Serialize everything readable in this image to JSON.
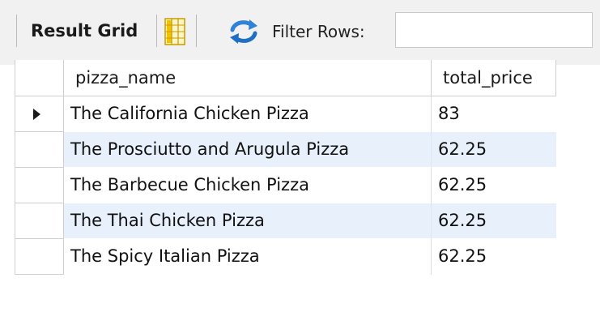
{
  "toolbar": {
    "title": "Result Grid",
    "filter_label": "Filter Rows:",
    "filter_value": "",
    "grid_icon": "grid-layout-icon",
    "refresh_icon": "refresh-icon"
  },
  "table": {
    "columns": [
      "pizza_name",
      "total_price"
    ],
    "rows": [
      {
        "pizza_name": "The California Chicken Pizza",
        "total_price": "83",
        "current": true
      },
      {
        "pizza_name": "The Prosciutto and Arugula Pizza",
        "total_price": "62.25",
        "current": false
      },
      {
        "pizza_name": "The Barbecue Chicken Pizza",
        "total_price": "62.25",
        "current": false
      },
      {
        "pizza_name": "The Thai Chicken Pizza",
        "total_price": "62.25",
        "current": false
      },
      {
        "pizza_name": "The Spicy Italian Pizza",
        "total_price": "62.25",
        "current": false
      }
    ]
  },
  "colors": {
    "toolbar_bg": "#f1f1f1",
    "alt_row_bg": "#e8f0fb",
    "grid_line": "#cfcfcf",
    "icon_yellow": "#f2c100",
    "icon_blue": "#2f82d8"
  }
}
